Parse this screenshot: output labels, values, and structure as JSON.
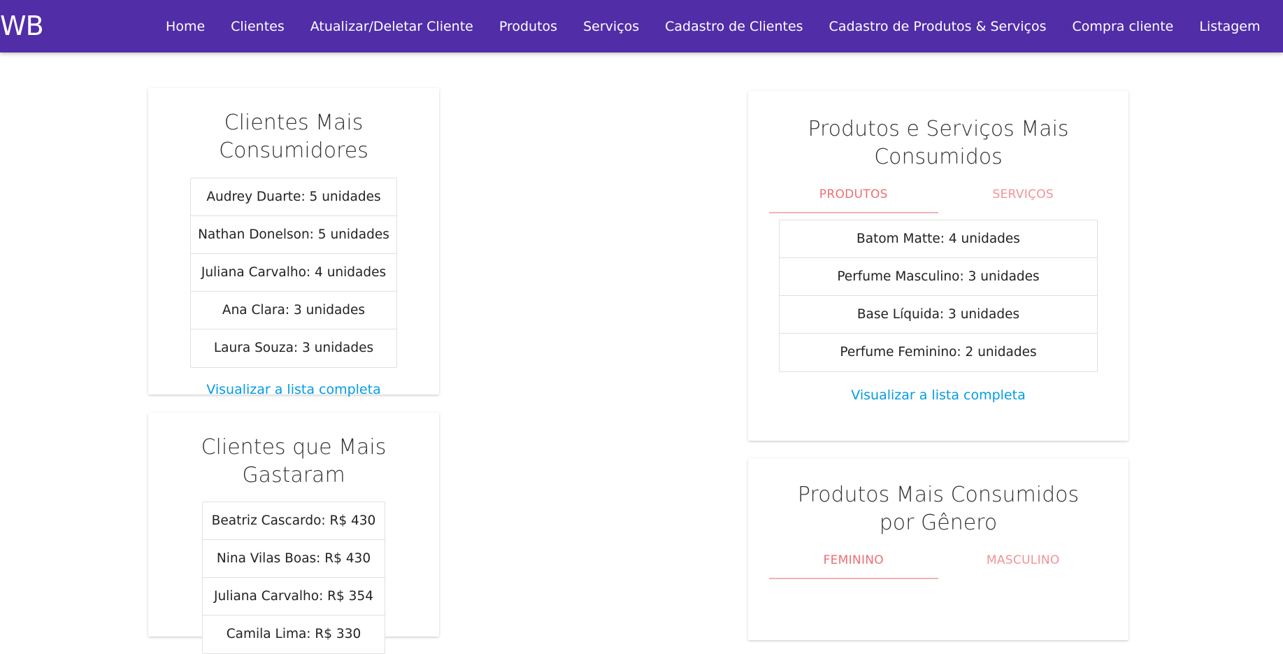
{
  "navbar": {
    "brand": "WB",
    "links": [
      {
        "label": "Home"
      },
      {
        "label": "Clientes"
      },
      {
        "label": "Atualizar/Deletar Cliente"
      },
      {
        "label": "Produtos"
      },
      {
        "label": "Serviços"
      },
      {
        "label": "Cadastro de Clientes"
      },
      {
        "label": "Cadastro de Produtos & Serviços"
      },
      {
        "label": "Compra cliente"
      },
      {
        "label": "Listagem"
      }
    ]
  },
  "top_clients": {
    "title": "Clientes Mais Consumidores",
    "items": [
      "Audrey Duarte: 5 unidades",
      "Nathan Donelson: 5 unidades",
      "Juliana Carvalho: 4 unidades",
      "Ana Clara: 3 unidades",
      "Laura Souza: 3 unidades"
    ],
    "link": "Visualizar a lista completa"
  },
  "top_spenders": {
    "title": "Clientes que Mais Gastaram",
    "items": [
      "Beatriz Cascardo: R$ 430",
      "Nina Vilas Boas: R$ 430",
      "Juliana Carvalho: R$ 354",
      "Camila Lima: R$ 330"
    ]
  },
  "top_products": {
    "title": "Produtos e Serviços Mais Consumidos",
    "tabs": [
      "PRODUTOS",
      "SERVIÇOS"
    ],
    "items": [
      "Batom Matte: 4 unidades",
      "Perfume Masculino: 3 unidades",
      "Base Líquida: 3 unidades",
      "Perfume Feminino: 2 unidades"
    ],
    "link": "Visualizar a lista completa"
  },
  "gender_products": {
    "title": "Produtos Mais Consumidos por Gênero",
    "tabs": [
      "FEMININO",
      "MASCULINO"
    ]
  },
  "colors": {
    "navbar": "#512da8",
    "link": "#039be5",
    "tab_text": "#ee6e73",
    "tab_indicator": "#f6b2b5"
  }
}
